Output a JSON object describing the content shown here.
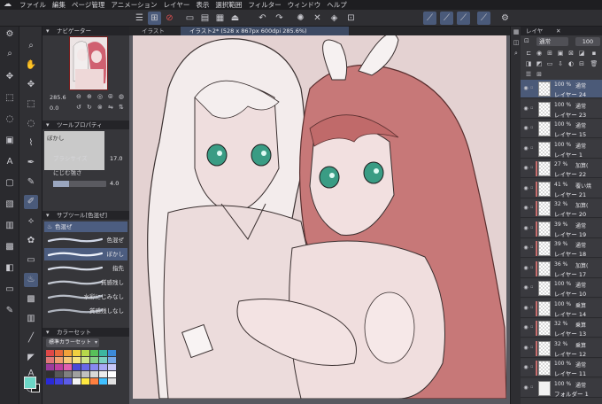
{
  "menu": {
    "items": [
      "ファイル",
      "編集",
      "ページ管理",
      "アニメーション",
      "レイヤー",
      "表示",
      "選択範囲",
      "フィルター",
      "ウィンドウ",
      "ヘルプ"
    ]
  },
  "command_bar": {
    "icons": [
      "menu-icon",
      "layer-property-icon",
      "no-entry-icon",
      "new-canvas-icon",
      "open-icon",
      "save-icon",
      "upload-icon",
      "undo-icon",
      "redo-icon",
      "loading-icon",
      "clear-icon",
      "fill-icon",
      "transform-icon",
      "pen-tool-icon",
      "pen-tool-icon",
      "pen-tool-icon",
      "pen-tool-icon",
      "settings-icon"
    ]
  },
  "navigator": {
    "title": "ナビゲーター",
    "zoom": "285.6",
    "rotation": "0.0"
  },
  "tool_property": {
    "title": "ツールプロパティ",
    "subtool_name": "ぼかし",
    "brush_size_label": "ブラシサイズ",
    "brush_size_value": "17.0",
    "blur_strength_label": "にじむ強さ",
    "blur_strength_value": "4.0",
    "brush_size_fraction": 0.55,
    "blur_strength_fraction": 0.3
  },
  "sub_tool": {
    "title": "サブツール[色混ぜ]",
    "group_label": "色混ぜ",
    "brushes": [
      {
        "name": "色混ぜ",
        "active": false
      },
      {
        "name": "ぼかし",
        "active": true
      },
      {
        "name": "指先",
        "active": false
      },
      {
        "name": "質感残し",
        "active": false
      },
      {
        "name": "水彩にじみなし",
        "active": false
      },
      {
        "name": "質感残しなし",
        "active": false
      }
    ]
  },
  "color_set": {
    "title": "カラーセット",
    "set_name": "標準カラーセット",
    "swatches": [
      "#e04848",
      "#e86a3c",
      "#f2a23a",
      "#f0d040",
      "#b6d84a",
      "#58c05a",
      "#3cb6a0",
      "#3c8ad8",
      "#e07878",
      "#f0a070",
      "#f6c878",
      "#f4e480",
      "#cde488",
      "#88d088",
      "#7ad0c0",
      "#78a8e8",
      "#9c3c9c",
      "#c040a0",
      "#e060b0",
      "#4a4ad8",
      "#6868e8",
      "#8888f0",
      "#a8a8f4",
      "#c8c8f8",
      "#303030",
      "#585858",
      "#808080",
      "#a0a0a0",
      "#c0c0c0",
      "#d8d8d8",
      "#ececec",
      "#ffffff",
      "#2a2ad8",
      "#4040e0",
      "#5c5ce8",
      "#f4f4f4",
      "#ffe840",
      "#ff8040",
      "#40c0ff",
      "#e0e0e0"
    ],
    "main_color": "#6cd6c6",
    "sub_color": "#1b1b1b"
  },
  "canvas": {
    "tabs": [
      {
        "label": "イラスト",
        "active": false
      },
      {
        "label": "イラスト2* (528 x 867px 600dpi 285.6%)",
        "active": true
      }
    ]
  },
  "layer_panel": {
    "tab_label": "レイヤ",
    "blend_mode": "通常",
    "opacity": "100",
    "layers": [
      {
        "percent": "100 %",
        "mode": "通常",
        "name": "レイヤー 24",
        "selected": true,
        "clip": false
      },
      {
        "percent": "100 %",
        "mode": "通常",
        "name": "レイヤー 23",
        "selected": false,
        "clip": false
      },
      {
        "percent": "100 %",
        "mode": "通常",
        "name": "レイヤー 15",
        "selected": false,
        "clip": false
      },
      {
        "percent": "100 %",
        "mode": "通常",
        "name": "レイヤー 1",
        "selected": false,
        "clip": false
      },
      {
        "percent": "27 %",
        "mode": "加算(",
        "name": "レイヤー 22",
        "selected": false,
        "clip": true
      },
      {
        "percent": "41 %",
        "mode": "覆い焼",
        "name": "レイヤー 21",
        "selected": false,
        "clip": true
      },
      {
        "percent": "32 %",
        "mode": "加算(",
        "name": "レイヤー 20",
        "selected": false,
        "clip": true
      },
      {
        "percent": "39 %",
        "mode": "通常",
        "name": "レイヤー 19",
        "selected": false,
        "clip": true
      },
      {
        "percent": "39 %",
        "mode": "通常",
        "name": "レイヤー 18",
        "selected": false,
        "clip": true
      },
      {
        "percent": "36 %",
        "mode": "加算(",
        "name": "レイヤー 17",
        "selected": false,
        "clip": true
      },
      {
        "percent": "100 %",
        "mode": "通常",
        "name": "レイヤー 10",
        "selected": false,
        "clip": false
      },
      {
        "percent": "100 %",
        "mode": "乗算",
        "name": "レイヤー 14",
        "selected": false,
        "clip": true
      },
      {
        "percent": "32 %",
        "mode": "乗算",
        "name": "レイヤー 13",
        "selected": false,
        "clip": true
      },
      {
        "percent": "32 %",
        "mode": "乗算",
        "name": "レイヤー 12",
        "selected": false,
        "clip": true
      },
      {
        "percent": "100 %",
        "mode": "通常",
        "name": "レイヤー 11",
        "selected": false,
        "clip": true
      },
      {
        "percent": "100 %",
        "mode": "通常",
        "name": "フォルダー 1",
        "selected": false,
        "clip": false
      }
    ]
  }
}
